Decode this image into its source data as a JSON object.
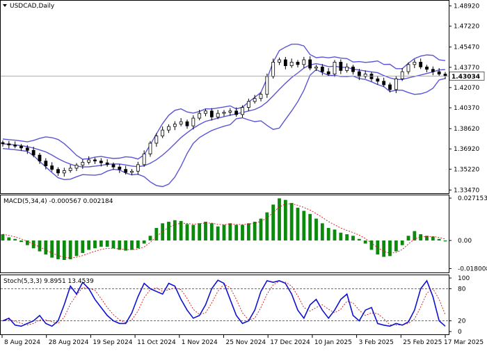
{
  "chart_data": [
    {
      "type": "line",
      "panel": "price",
      "symbol_label": "USDCAD,Daily",
      "series": [
        {
          "kind": "candles",
          "values": [
            1.3735,
            1.3725,
            1.3715,
            1.37,
            1.368,
            1.364,
            1.359,
            1.355,
            1.352,
            1.349,
            1.351,
            1.353,
            1.3555,
            1.358,
            1.36,
            1.359,
            1.3575,
            1.356,
            1.354,
            1.352,
            1.3495,
            1.3505,
            1.356,
            1.365,
            1.374,
            1.38,
            1.385,
            1.388,
            1.39,
            1.392,
            1.3885,
            1.395,
            1.399,
            1.401,
            1.396,
            1.399,
            1.4,
            1.401,
            1.398,
            1.404,
            1.409,
            1.4115,
            1.415,
            1.43,
            1.442,
            1.444,
            1.439,
            1.442,
            1.44,
            1.444,
            1.437,
            1.438,
            1.434,
            1.432,
            1.442,
            1.435,
            1.438,
            1.434,
            1.43,
            1.432,
            1.428,
            1.426,
            1.423,
            1.419,
            1.428,
            1.434,
            1.44,
            1.442,
            1.438,
            1.436,
            1.434,
            1.432,
            1.4303
          ]
        },
        {
          "kind": "bollinger_upper"
        },
        {
          "kind": "bollinger_middle"
        },
        {
          "kind": "bollinger_lower"
        }
      ],
      "current_price": "1.43034",
      "ylim": [
        1.332,
        1.493
      ],
      "y_ticks": [
        "1.48920",
        "1.47220",
        "1.45470",
        "1.43770",
        "1.42070",
        "1.40370",
        "1.38620",
        "1.36920",
        "1.35220",
        "1.33470"
      ],
      "x_ticks": [
        "8 Aug 2024",
        "28 Aug 2024",
        "19 Sep 2024",
        "11 Oct 2024",
        "1 Nov 2024",
        "25 Nov 2024",
        "17 Dec 2024",
        "10 Jan 2025",
        "3 Feb 2025",
        "25 Feb 2025",
        "17 Mar 2025"
      ]
    },
    {
      "type": "bar",
      "panel": "macd",
      "label": "MACD(5,34,4) -0.000567 0.002184",
      "y_ticks": [
        "0.027153",
        "0.00",
        "-0.018008"
      ],
      "ylim": [
        -0.0205,
        0.0285
      ],
      "series": [
        {
          "name": "MACD",
          "values": [
            0.004,
            0.002,
            0.001,
            -0.001,
            -0.003,
            -0.005,
            -0.007,
            -0.009,
            -0.011,
            -0.012,
            -0.0125,
            -0.012,
            -0.01,
            -0.008,
            -0.006,
            -0.005,
            -0.004,
            -0.004,
            -0.005,
            -0.006,
            -0.0065,
            -0.006,
            -0.005,
            -0.002,
            0.003,
            0.008,
            0.011,
            0.012,
            0.013,
            0.0125,
            0.0105,
            0.01,
            0.011,
            0.012,
            0.011,
            0.009,
            0.01,
            0.011,
            0.01,
            0.01,
            0.011,
            0.012,
            0.014,
            0.018,
            0.023,
            0.027,
            0.026,
            0.024,
            0.021,
            0.019,
            0.017,
            0.014,
            0.011,
            0.008,
            0.007,
            0.005,
            0.004,
            0.003,
            0.001,
            -0.002,
            -0.006,
            -0.009,
            -0.0105,
            -0.01,
            -0.007,
            -0.003,
            0.003,
            0.006,
            0.004,
            0.003,
            0.0025,
            0.001,
            -0.0006
          ]
        },
        {
          "name": "Signal"
        }
      ]
    },
    {
      "type": "line",
      "panel": "stochastic",
      "label": "Stoch(5,3,3) 9.8951 13.4539",
      "y_ticks": [
        "100",
        "80",
        "20",
        "0"
      ],
      "ylim": [
        0,
        100
      ],
      "levels": [
        80,
        20
      ],
      "series": [
        {
          "name": "%K",
          "values": [
            20,
            25,
            12,
            10,
            15,
            20,
            30,
            15,
            10,
            20,
            50,
            85,
            70,
            92,
            80,
            60,
            45,
            30,
            20,
            15,
            15,
            35,
            65,
            90,
            80,
            75,
            70,
            90,
            85,
            60,
            40,
            25,
            30,
            50,
            80,
            96,
            90,
            60,
            30,
            15,
            20,
            40,
            75,
            95,
            92,
            95,
            90,
            70,
            40,
            25,
            50,
            60,
            40,
            25,
            40,
            60,
            70,
            30,
            20,
            40,
            45,
            15,
            12,
            10,
            15,
            12,
            18,
            40,
            80,
            95,
            65,
            20,
            10
          ]
        },
        {
          "name": "%D"
        }
      ]
    }
  ]
}
